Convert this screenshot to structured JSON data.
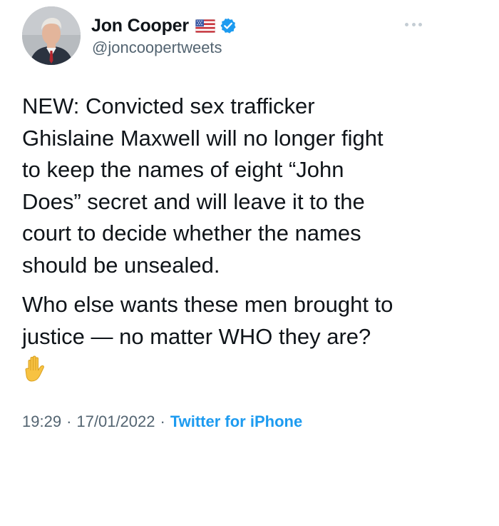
{
  "author": {
    "display_name": "Jon Cooper",
    "handle": "@joncoopertweets",
    "flag_emoji": "us-flag-icon",
    "verified": true
  },
  "tweet": {
    "paragraphs": [
      "NEW: Convicted sex trafficker\nGhislaine Maxwell will no longer fight\nto keep the names of eight “John\nDoes” secret and will leave it to the\ncourt to decide whether the names\nshould be unsealed.",
      "Who else wants these men brought to\njustice — no matter WHO they are?"
    ],
    "trailing_emoji": "raised-hand-icon"
  },
  "meta": {
    "time": "19:29",
    "date": "17/01/2022",
    "separator": "·",
    "source": "Twitter for iPhone"
  },
  "colors": {
    "text": "#0f1419",
    "secondary": "#536471",
    "link": "#1d9bf0",
    "verified": "#1d9bf0"
  }
}
